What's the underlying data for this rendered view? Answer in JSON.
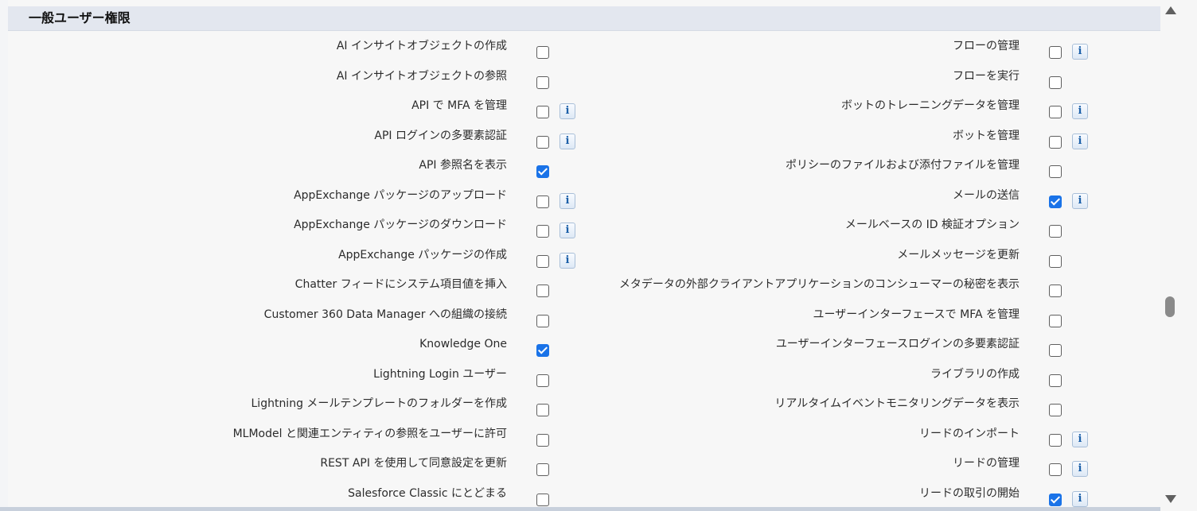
{
  "section": {
    "title": "一般ユーザー権限"
  },
  "left_rows": [
    {
      "label": "AI インサイトオブジェクトの作成",
      "checked": false,
      "info": false
    },
    {
      "label": "AI インサイトオブジェクトの参照",
      "checked": false,
      "info": false
    },
    {
      "label": "API で MFA を管理",
      "checked": false,
      "info": true
    },
    {
      "label": "API ログインの多要素認証",
      "checked": false,
      "info": true
    },
    {
      "label": "API 参照名を表示",
      "checked": true,
      "info": false
    },
    {
      "label": "AppExchange パッケージのアップロード",
      "checked": false,
      "info": true
    },
    {
      "label": "AppExchange パッケージのダウンロード",
      "checked": false,
      "info": true
    },
    {
      "label": "AppExchange パッケージの作成",
      "checked": false,
      "info": true
    },
    {
      "label": "Chatter フィードにシステム項目値を挿入",
      "checked": false,
      "info": false
    },
    {
      "label": "Customer 360 Data Manager への組織の接続",
      "checked": false,
      "info": false
    },
    {
      "label": "Knowledge One",
      "checked": true,
      "info": false
    },
    {
      "label": "Lightning Login ユーザー",
      "checked": false,
      "info": false
    },
    {
      "label": "Lightning メールテンプレートのフォルダーを作成",
      "checked": false,
      "info": false
    },
    {
      "label": "MLModel と関連エンティティの参照をユーザーに許可",
      "checked": false,
      "info": false
    },
    {
      "label": "REST API を使用して同意設定を更新",
      "checked": false,
      "info": false
    },
    {
      "label": "Salesforce Classic にとどまる",
      "checked": false,
      "info": false
    }
  ],
  "right_rows": [
    {
      "label": "フローの管理",
      "checked": false,
      "info": true
    },
    {
      "label": "フローを実行",
      "checked": false,
      "info": false
    },
    {
      "label": "ボットのトレーニングデータを管理",
      "checked": false,
      "info": true
    },
    {
      "label": "ボットを管理",
      "checked": false,
      "info": true
    },
    {
      "label": "ポリシーのファイルおよび添付ファイルを管理",
      "checked": false,
      "info": false
    },
    {
      "label": "メールの送信",
      "checked": true,
      "info": true
    },
    {
      "label": "メールベースの ID 検証オプション",
      "checked": false,
      "info": false
    },
    {
      "label": "メールメッセージを更新",
      "checked": false,
      "info": false
    },
    {
      "label": "メタデータの外部クライアントアプリケーションのコンシューマーの秘密を表示",
      "checked": false,
      "info": false
    },
    {
      "label": "ユーザーインターフェースで MFA を管理",
      "checked": false,
      "info": false
    },
    {
      "label": "ユーザーインターフェースログインの多要素認証",
      "checked": false,
      "info": false
    },
    {
      "label": "ライブラリの作成",
      "checked": false,
      "info": false
    },
    {
      "label": "リアルタイムイベントモニタリングデータを表示",
      "checked": false,
      "info": false
    },
    {
      "label": "リードのインポート",
      "checked": false,
      "info": true
    },
    {
      "label": "リードの管理",
      "checked": false,
      "info": true
    },
    {
      "label": "リードの取引の開始",
      "checked": true,
      "info": true
    }
  ],
  "info_glyph": "i",
  "colors": {
    "header_bg": "#e3e7ef",
    "checkbox_checked": "#1a73e8"
  }
}
